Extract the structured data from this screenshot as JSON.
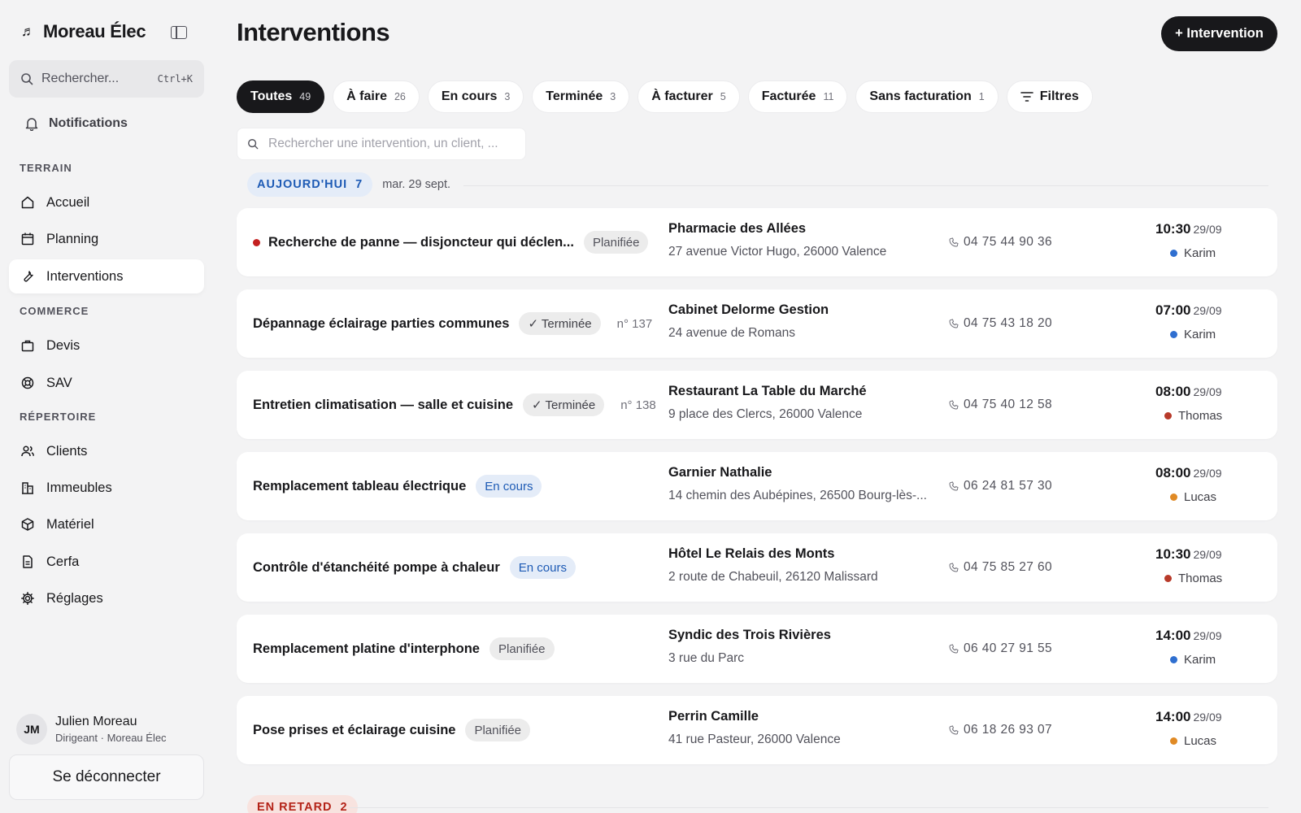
{
  "app": {
    "name": "Moreau Élec"
  },
  "sidebar": {
    "search_placeholder": "Rechercher...",
    "search_shortcut": "Ctrl+K",
    "notifications_label": "Notifications",
    "sections": {
      "terrain": "TERRAIN",
      "commerce": "COMMERCE",
      "repertoire": "RÉPERTOIRE"
    },
    "items": {
      "accueil": "Accueil",
      "planning": "Planning",
      "interventions": "Interventions",
      "devis": "Devis",
      "sav": "SAV",
      "clients": "Clients",
      "immeubles": "Immeubles",
      "materiel": "Matériel",
      "cerfa": "Cerfa",
      "reglages": "Réglages"
    },
    "user": {
      "initials": "JM",
      "name": "Julien Moreau",
      "role": "Dirigeant · Moreau Élec"
    },
    "logout_label": "Se déconnecter"
  },
  "main": {
    "title": "Interventions",
    "new_button": "+ Intervention",
    "tabs": [
      {
        "label": "Toutes",
        "count": "49"
      },
      {
        "label": "À faire",
        "count": "26"
      },
      {
        "label": "En cours",
        "count": "3"
      },
      {
        "label": "Terminée",
        "count": "3"
      },
      {
        "label": "À facturer",
        "count": "5"
      },
      {
        "label": "Facturée",
        "count": "11"
      },
      {
        "label": "Sans facturation",
        "count": "1"
      }
    ],
    "filters_label": "Filtres",
    "search_placeholder": "Rechercher une intervention, un client, ...",
    "groups": {
      "today": {
        "label": "AUJOURD'HUI",
        "count": "7",
        "date": "mar. 29 sept."
      },
      "late": {
        "label": "EN RETARD",
        "count": "2"
      }
    },
    "rows": [
      {
        "title": "Recherche de panne — disjoncteur qui déclen...",
        "status": "Planifiée",
        "number": "",
        "client": "Pharmacie des Allées",
        "address": "27 avenue Victor Hugo, 26000 Valence",
        "phone": "04 75 44 90 36",
        "time": "10:30",
        "date": "29/09",
        "tech": "Karim"
      },
      {
        "title": "Dépannage éclairage parties communes",
        "status": "✓ Terminée",
        "number": "n° 137",
        "client": "Cabinet Delorme Gestion",
        "address": "24 avenue de Romans",
        "phone": "04 75 43 18 20",
        "time": "07:00",
        "date": "29/09",
        "tech": "Karim"
      },
      {
        "title": "Entretien climatisation — salle et cuisine",
        "status": "✓ Terminée",
        "number": "n° 138",
        "client": "Restaurant La Table du Marché",
        "address": "9 place des Clercs, 26000 Valence",
        "phone": "04 75 40 12 58",
        "time": "08:00",
        "date": "29/09",
        "tech": "Thomas"
      },
      {
        "title": "Remplacement tableau électrique",
        "status": "En cours",
        "number": "",
        "client": "Garnier Nathalie",
        "address": "14 chemin des Aubépines, 26500 Bourg-lès-...",
        "phone": "06 24 81 57 30",
        "time": "08:00",
        "date": "29/09",
        "tech": "Lucas"
      },
      {
        "title": "Contrôle d'étanchéité pompe à chaleur",
        "status": "En cours",
        "number": "",
        "client": "Hôtel Le Relais des Monts",
        "address": "2 route de Chabeuil, 26120 Malissard",
        "phone": "04 75 85 27 60",
        "time": "10:30",
        "date": "29/09",
        "tech": "Thomas"
      },
      {
        "title": "Remplacement platine d'interphone",
        "status": "Planifiée",
        "number": "",
        "client": "Syndic des Trois Rivières",
        "address": "3 rue du Parc",
        "phone": "06 40 27 91 55",
        "time": "14:00",
        "date": "29/09",
        "tech": "Karim"
      },
      {
        "title": "Pose prises et éclairage cuisine",
        "status": "Planifiée",
        "number": "",
        "client": "Perrin Camille",
        "address": "41 rue Pasteur, 26000 Valence",
        "phone": "06 18 26 93 07",
        "time": "14:00",
        "date": "29/09",
        "tech": "Lucas"
      }
    ]
  },
  "colors": {
    "urgent": "#c42020",
    "tech_karim": "#2f6fd0",
    "tech_thomas": "#b83a2a",
    "tech_lucas": "#e08a25",
    "accent_dark": "#18181b"
  }
}
